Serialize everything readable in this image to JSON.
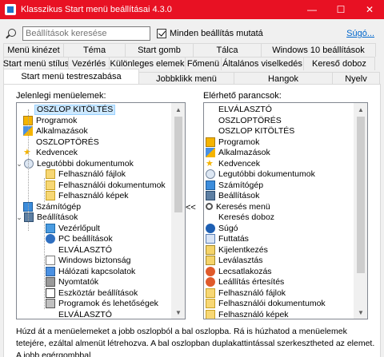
{
  "window": {
    "title": "Klasszikus Start menü beállításai 4.3.0",
    "minimize_glyph": "—",
    "maximize_glyph": "☐",
    "close_glyph": "✕"
  },
  "search": {
    "placeholder": "Beállítások keresése",
    "show_all_label": "Minden beállítás mutatá",
    "help_label": "Súgó..."
  },
  "tabs": {
    "row1": [
      "Menü kinézet",
      "Téma",
      "Start gomb",
      "Tálca",
      "Windows 10 beállítások"
    ],
    "row2": [
      "Start menü stílus",
      "Vezérlés",
      "Különleges elemek",
      "Főmenü",
      "Általános viselkedés",
      "Kereső doboz"
    ],
    "row3": [
      "Start menü testreszabása",
      "Jobbklikk menü",
      "Hangok",
      "Nyelv"
    ],
    "active": "Start menü testreszabása"
  },
  "left": {
    "label": "Jelenlegi menüelemek:",
    "items": [
      {
        "text": "OSZLOP KITÖLTÉS",
        "icon": "none",
        "level": 0,
        "selected": true
      },
      {
        "text": "Programok",
        "icon": "programs-icon",
        "level": 0
      },
      {
        "text": "Alkalmazások",
        "icon": "apps-icon",
        "level": 0
      },
      {
        "text": "OSZLOPTÖRÉS",
        "icon": "none",
        "level": 0
      },
      {
        "text": "Kedvencek",
        "icon": "star-icon",
        "level": 0
      },
      {
        "text": "Legutóbbi dokumentumok",
        "icon": "recent-docs-icon",
        "level": 0,
        "expanded": true
      },
      {
        "text": "Felhasználó fájlok",
        "icon": "user-files-icon",
        "level": 1
      },
      {
        "text": "Felhasználói dokumentumok",
        "icon": "documents-icon",
        "level": 1
      },
      {
        "text": "Felhasználó képek",
        "icon": "pictures-icon",
        "level": 1
      },
      {
        "text": "Számítógép",
        "icon": "computer-icon",
        "level": 0
      },
      {
        "text": "Beállítások",
        "icon": "settings-icon",
        "level": 0,
        "expanded": true
      },
      {
        "text": "Vezérlőpult",
        "icon": "control-panel-icon",
        "level": 1
      },
      {
        "text": "PC beállítások",
        "icon": "gear-icon",
        "level": 1
      },
      {
        "text": "ELVÁLASZTÓ",
        "icon": "none",
        "level": 1
      },
      {
        "text": "Windows biztonság",
        "icon": "shield-icon",
        "level": 1
      },
      {
        "text": "Hálózati kapcsolatok",
        "icon": "network-icon",
        "level": 1
      },
      {
        "text": "Nyomtatók",
        "icon": "printer-icon",
        "level": 1
      },
      {
        "text": "Eszköztár beállítások",
        "icon": "taskbar-icon",
        "level": 1
      },
      {
        "text": "Programok és lehetőségek",
        "icon": "programs-features-icon",
        "level": 1
      },
      {
        "text": "ELVÁLASZTÓ",
        "icon": "none",
        "level": 1
      }
    ]
  },
  "move_button": "<<",
  "right": {
    "label": "Elérhető parancsok:",
    "items": [
      {
        "text": "ELVÁLASZTÓ",
        "icon": "none"
      },
      {
        "text": "OSZLOPTÖRÉS",
        "icon": "none"
      },
      {
        "text": "OSZLOP KITÖLTÉS",
        "icon": "none"
      },
      {
        "text": "Programok",
        "icon": "programs-icon"
      },
      {
        "text": "Alkalmazások",
        "icon": "apps-icon"
      },
      {
        "text": "Kedvencek",
        "icon": "star-icon"
      },
      {
        "text": "Legutóbbi dokumentumok",
        "icon": "recent-docs-icon"
      },
      {
        "text": "Számítógép",
        "icon": "computer-icon"
      },
      {
        "text": "Beállítások",
        "icon": "settings-icon"
      },
      {
        "text": "Keresés menü",
        "icon": "search-icon"
      },
      {
        "text": "Keresés doboz",
        "icon": "none"
      },
      {
        "text": "Súgó",
        "icon": "help-icon"
      },
      {
        "text": "Futtatás",
        "icon": "run-icon"
      },
      {
        "text": "Kijelentkezés",
        "icon": "logoff-icon"
      },
      {
        "text": "Leválasztás",
        "icon": "disconnect-icon"
      },
      {
        "text": "Lecsatlakozás",
        "icon": "undock-icon"
      },
      {
        "text": "Leállítás értesítés",
        "icon": "shutdown-icon"
      },
      {
        "text": "Felhasználó fájlok",
        "icon": "user-files-icon"
      },
      {
        "text": "Felhasználói dokumentumok",
        "icon": "documents-icon"
      },
      {
        "text": "Felhasználó képek",
        "icon": "pictures-icon"
      }
    ]
  },
  "note": "Húzd át a menüelemeket a jobb oszlopból a bal oszlopba. Rá is húzhatod a menüelemek tetejére, ezáltal almenüt létrehozva. A bal oszlopban duplakattintással szerkesztheted az elemet. A jobb egérgombbal"
}
